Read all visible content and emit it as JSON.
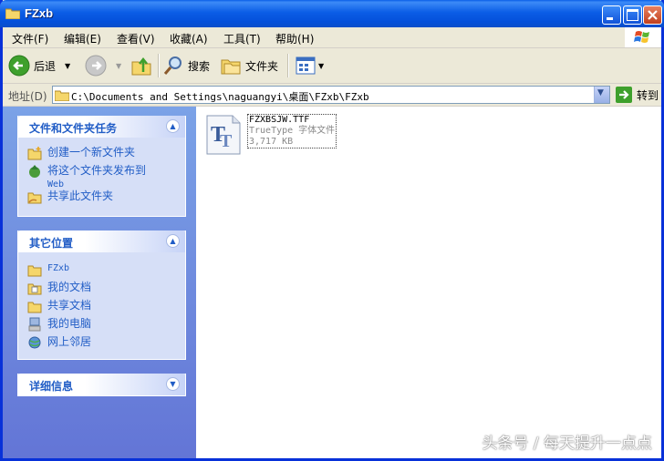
{
  "window": {
    "title": "FZxb"
  },
  "menubar": {
    "items": [
      "文件(F)",
      "编辑(E)",
      "查看(V)",
      "收藏(A)",
      "工具(T)",
      "帮助(H)"
    ]
  },
  "toolbar": {
    "back_label": "后退",
    "search_label": "搜索",
    "folders_label": "文件夹"
  },
  "address": {
    "label": "地址(D)",
    "path": "C:\\Documents and Settings\\naguangyi\\桌面\\FZxb\\FZxb",
    "go_label": "转到"
  },
  "tasks": {
    "title": "文件和文件夹任务",
    "items": [
      "创建一个新文件夹",
      "将这个文件夹发布到",
      "Web",
      "共享此文件夹"
    ]
  },
  "places": {
    "title": "其它位置",
    "items": [
      "FZxb",
      "我的文档",
      "共享文档",
      "我的电脑",
      "网上邻居"
    ]
  },
  "details": {
    "title": "详细信息"
  },
  "file": {
    "name": "FZXBSJW.TTF",
    "type": "TrueType 字体文件",
    "size": "3,717 KB"
  },
  "watermark": "头条号 / 每天提升一点点",
  "colors": {
    "title_bar": "#0A5FE8",
    "task_pane": "#6F8FDE",
    "link": "#215DC6"
  }
}
